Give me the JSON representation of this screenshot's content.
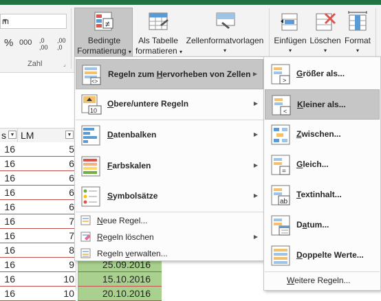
{
  "ribbon": {
    "number_format_value": "m",
    "percent_label": "%",
    "thousands_label": "000",
    "dec_increase_label": ",0 ,00",
    "dec_decrease_label": ",00 ,0",
    "group_label_number": "Zahl",
    "cond_format_line1": "Bedingte",
    "cond_format_line2": "Formatierung",
    "format_table_line1": "Als Tabelle",
    "format_table_line2": "formatieren",
    "cell_styles_label": "Zellenformatvorlagen",
    "insert_label": "Einfügen",
    "delete_label": "Löschen",
    "format_label": "Format"
  },
  "sheet": {
    "col_a_header": "s",
    "col_b_header": "LM",
    "rows": [
      {
        "a": "16",
        "b": "5"
      },
      {
        "a": "16",
        "b": "6"
      },
      {
        "a": "16",
        "b": "6"
      },
      {
        "a": "16",
        "b": "6"
      },
      {
        "a": "16",
        "b": "6"
      },
      {
        "a": "16",
        "b": "7"
      },
      {
        "a": "16",
        "b": "7"
      },
      {
        "a": "16",
        "b": "8"
      },
      {
        "a": "16",
        "b": "9"
      },
      {
        "a": "16",
        "b": "10"
      },
      {
        "a": "16",
        "b": "10"
      }
    ],
    "dates": [
      "25.09.2016",
      "15.10.2016",
      "20.10.2016"
    ]
  },
  "menu": {
    "items": [
      {
        "label_pre": "Regeln zum ",
        "label_u": "H",
        "label_post": "ervorheben von Zellen"
      },
      {
        "label_pre": "",
        "label_u": "O",
        "label_post": "bere/untere Regeln"
      },
      {
        "label_pre": "",
        "label_u": "D",
        "label_post": "atenbalken"
      },
      {
        "label_pre": "",
        "label_u": "F",
        "label_post": "arbskalen"
      },
      {
        "label_pre": "",
        "label_u": "S",
        "label_post": "ymbolsätze"
      }
    ],
    "small_items": [
      {
        "label_pre": "",
        "label_u": "N",
        "label_post": "eue Regel..."
      },
      {
        "label_pre": "",
        "label_u": "R",
        "label_post": "egeln löschen"
      },
      {
        "label_pre": "Regeln ",
        "label_u": "v",
        "label_post": "erwalten..."
      }
    ]
  },
  "submenu": {
    "items": [
      {
        "label_pre": "",
        "label_u": "G",
        "label_post": "rößer als..."
      },
      {
        "label_pre": "",
        "label_u": "K",
        "label_post": "leiner als..."
      },
      {
        "label_pre": "",
        "label_u": "Z",
        "label_post": "wischen..."
      },
      {
        "label_pre": "",
        "label_u": "G",
        "label_post": "leich..."
      },
      {
        "label_pre": "",
        "label_u": "T",
        "label_post": "extinhalt..."
      },
      {
        "label_pre": "D",
        "label_u": "a",
        "label_post": "tum..."
      },
      {
        "label_pre": "",
        "label_u": "D",
        "label_post": "oppelte Werte..."
      }
    ],
    "more_rules_pre": "",
    "more_rules_u": "W",
    "more_rules_post": "eitere Regeln...",
    "icon_badges": [
      ">",
      "<",
      "",
      "=",
      "ab",
      "",
      ""
    ]
  },
  "colors": {
    "excel_green": "#217346",
    "highlight": "#c6c6c6",
    "date_fill": "#a9d08e",
    "row_border": "#c0504d"
  }
}
